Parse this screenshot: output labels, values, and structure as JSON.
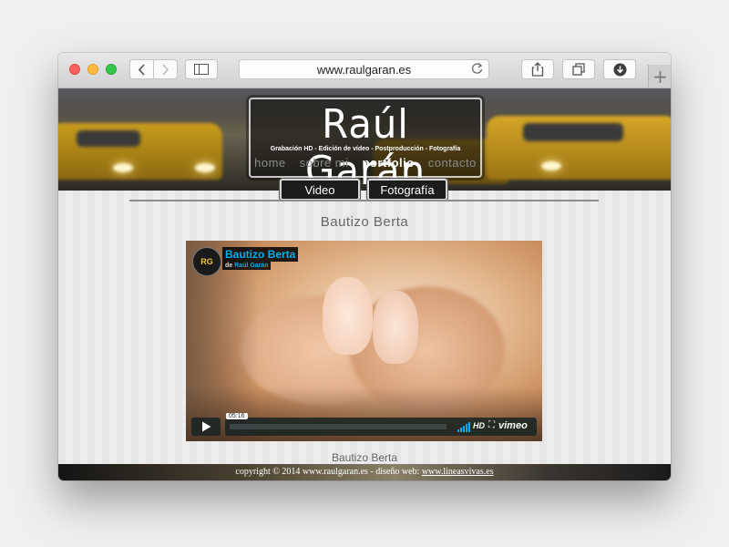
{
  "browser": {
    "url": "www.raulgaran.es",
    "new_tab_label": "+"
  },
  "site": {
    "title": "Raúl Garán",
    "tagline": "Grabación HD - Edición de vídeo - Postproducción - Fotografía",
    "menu": [
      {
        "label": "home",
        "active": false
      },
      {
        "label": "sobre mi",
        "active": false
      },
      {
        "label": "portfolio",
        "active": true
      },
      {
        "label": "contacto",
        "active": false
      }
    ],
    "subtabs": {
      "video": "Video",
      "foto": "Fotografía"
    }
  },
  "content": {
    "video_heading": "Bautizo Berta",
    "caption": "Bautizo Berta"
  },
  "player": {
    "logo_text": "RG",
    "title": "Bautizo Berta",
    "by_prefix": "de",
    "by_author": "Raúl Garán",
    "timecode": "05:16",
    "hd": "HD",
    "fullscreen": "⛶",
    "brand": "vimeo",
    "accent": "#00adef"
  },
  "footer": {
    "text": "copyright © 2014 www.raulgaran.es - diseño web: ",
    "link": "www.lineasvivas.es"
  }
}
